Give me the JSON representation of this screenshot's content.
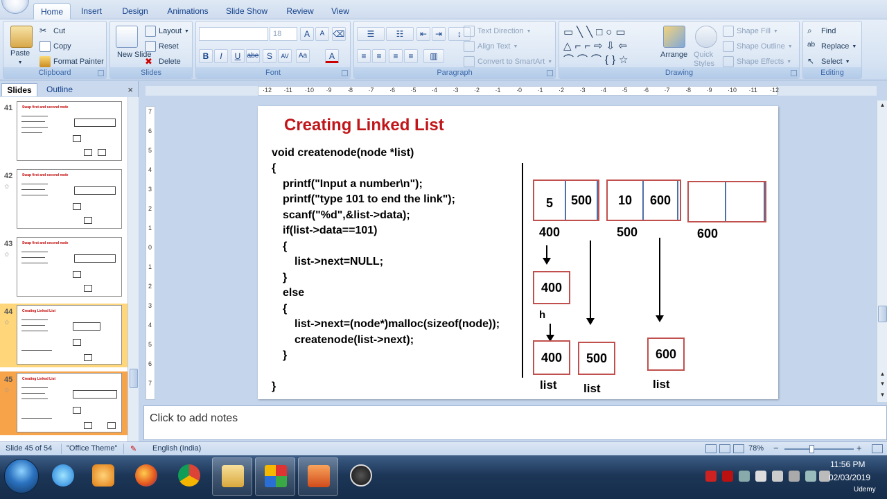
{
  "ribbon": {
    "tabs": [
      "Home",
      "Insert",
      "Design",
      "Animations",
      "Slide Show",
      "Review",
      "View"
    ],
    "clipboard": {
      "paste": "Paste",
      "cut": "Cut",
      "copy": "Copy",
      "format_painter": "Format Painter",
      "label": "Clipboard"
    },
    "slides": {
      "new_slide": "New Slide",
      "layout": "Layout",
      "reset": "Reset",
      "delete": "Delete",
      "label": "Slides"
    },
    "font": {
      "font_size": "18",
      "label": "Font",
      "bold": "B",
      "italic": "I",
      "underline": "U",
      "strike": "abe",
      "shadow": "S",
      "spacing": "AV",
      "case": "Aa",
      "color": "A"
    },
    "paragraph": {
      "text_direction": "Text Direction",
      "align_text": "Align Text",
      "convert": "Convert to SmartArt",
      "label": "Paragraph"
    },
    "drawing": {
      "arrange": "Arrange",
      "quick_styles": "Quick Styles",
      "shape_fill": "Shape Fill",
      "shape_outline": "Shape Outline",
      "shape_effects": "Shape Effects",
      "label": "Drawing"
    },
    "editing": {
      "find": "Find",
      "replace": "Replace",
      "select": "Select",
      "label": "Editing"
    }
  },
  "panel": {
    "tabs": [
      "Slides",
      "Outline"
    ],
    "close": "×",
    "thumbnails": [
      {
        "num": "41",
        "title": "Swap first and second node"
      },
      {
        "num": "42",
        "title": "Swap first and second node"
      },
      {
        "num": "43",
        "title": "Swap first and second node"
      },
      {
        "num": "44",
        "title": "Creating Linked List"
      },
      {
        "num": "45",
        "title": "Creating Linked List"
      }
    ]
  },
  "ruler": {
    "h_ticks": [
      "12",
      "11",
      "10",
      "9",
      "8",
      "7",
      "6",
      "5",
      "4",
      "3",
      "2",
      "1",
      "0",
      "1",
      "2",
      "3",
      "4",
      "5",
      "6",
      "7",
      "8",
      "9",
      "10",
      "11",
      "12"
    ],
    "v_ticks": [
      "7",
      "6",
      "5",
      "4",
      "3",
      "2",
      "1",
      "0",
      "1",
      "2",
      "3",
      "4",
      "5",
      "6",
      "7"
    ]
  },
  "slide": {
    "title": "Creating Linked List",
    "code": [
      "void createnode(node *list)",
      "{",
      "printf(\"Input a number\\n\");",
      "printf(\"type 101 to end the link\");",
      "scanf(\"%d\",&list->data);",
      "if(list->data==101)",
      "{",
      "list->next=NULL;",
      "}",
      "else",
      "{",
      "list->next=(node*)malloc(sizeof(node));",
      "createnode(list->next);",
      "}",
      "}"
    ],
    "nodes": [
      {
        "data": "5",
        "next": "500",
        "addr": "400"
      },
      {
        "data": "10",
        "next": "600",
        "addr": "500"
      },
      {
        "data": "",
        "next": "",
        "addr": "600"
      }
    ],
    "head_box": "400",
    "head_label": "h",
    "list_boxes": [
      {
        "value": "400",
        "label": "list"
      },
      {
        "value": "500",
        "label": "list"
      },
      {
        "value": "600",
        "label": "list"
      }
    ]
  },
  "notes": {
    "placeholder": "Click to add notes"
  },
  "status": {
    "slide_info": "Slide 45 of 54",
    "theme": "\"Office Theme\"",
    "language": "English (India)",
    "zoom": "78%",
    "zoom_minus": "−",
    "zoom_plus": "+"
  },
  "taskbar": {
    "time": "11:56 PM",
    "date": "02/03/2019",
    "watermark": "Udemy"
  }
}
